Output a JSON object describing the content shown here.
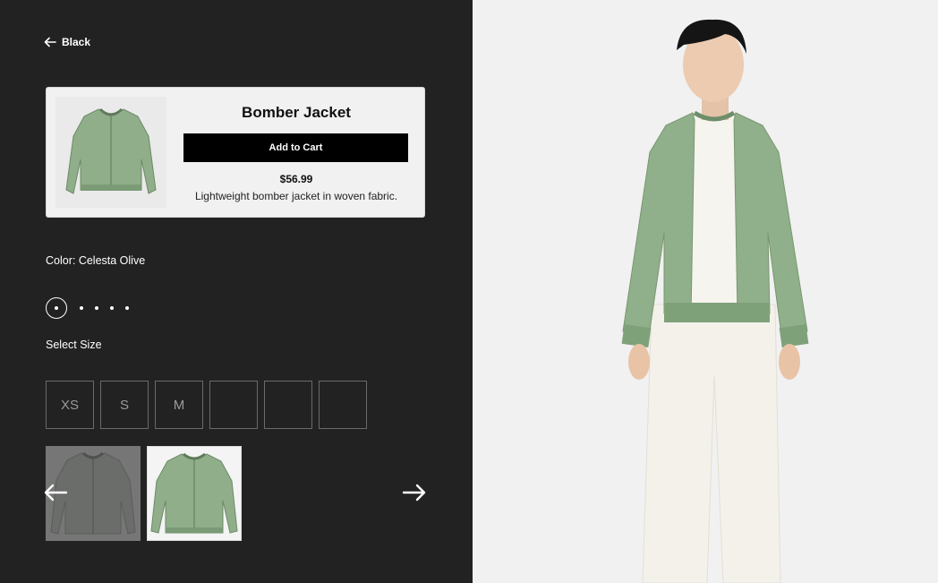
{
  "nav": {
    "back_label": "Black"
  },
  "product": {
    "title": "Bomber Jacket",
    "add_to_cart_label": "Add to Cart",
    "price": "$56.99",
    "description": "Lightweight bomber jacket in woven fabric."
  },
  "color": {
    "label": "Color: Celesta Olive",
    "swatch_count": 5,
    "selected_index": 0
  },
  "size": {
    "label": "Select Size",
    "options": [
      "XS",
      "S",
      "M",
      "",
      "",
      ""
    ]
  },
  "colors": {
    "panel_bg": "#222222",
    "jacket_green": "#8fb08a",
    "page_bg": "#f1f1f1",
    "button_bg": "#000000"
  },
  "icons": {
    "back": "arrow-left-icon",
    "prev": "arrow-left-icon",
    "next": "arrow-right-icon"
  }
}
